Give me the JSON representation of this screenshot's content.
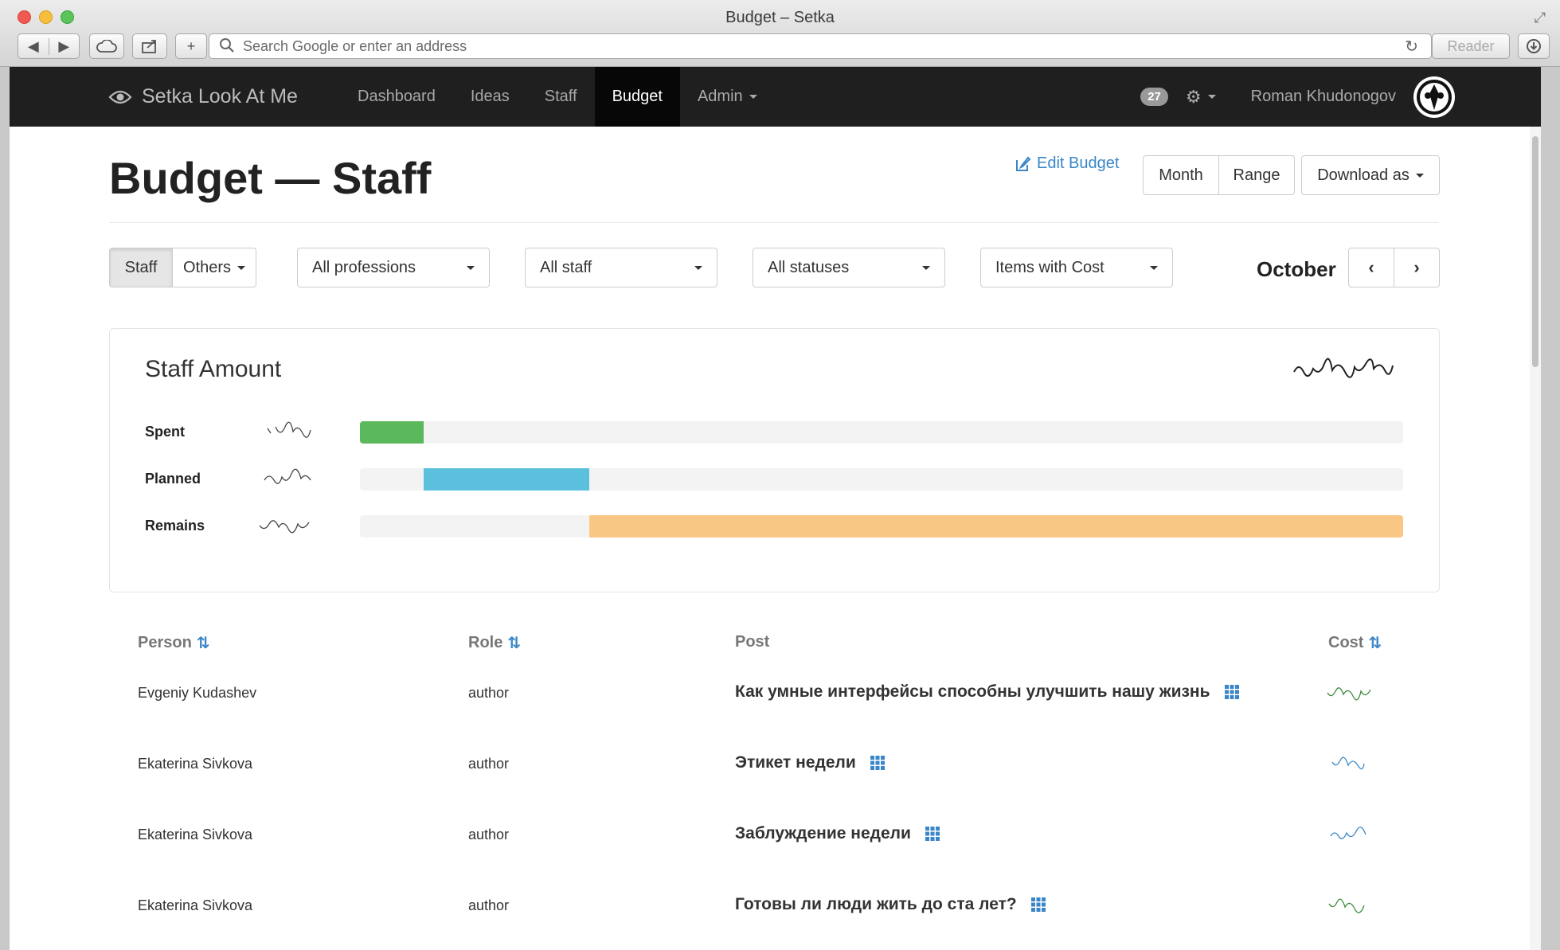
{
  "window": {
    "title": "Budget – Setka"
  },
  "browser": {
    "address_placeholder": "Search Google or enter an address",
    "reader_label": "Reader"
  },
  "navbar": {
    "brand": "Setka Look At Me",
    "items": [
      {
        "label": "Dashboard",
        "active": false
      },
      {
        "label": "Ideas",
        "active": false
      },
      {
        "label": "Staff",
        "active": false
      },
      {
        "label": "Budget",
        "active": true
      },
      {
        "label": "Admin",
        "active": false
      }
    ],
    "notifications": "27",
    "user_name": "Roman Khudonogov"
  },
  "header": {
    "title": "Budget — Staff",
    "edit_label": "Edit Budget",
    "month_label": "Month",
    "range_label": "Range",
    "download_label": "Download as"
  },
  "filters": {
    "staff_label": "Staff",
    "others_label": "Others",
    "professions": "All professions",
    "staff": "All staff",
    "statuses": "All statuses",
    "cost": "Items with Cost",
    "current_month": "October"
  },
  "summary": {
    "title": "Staff Amount",
    "rows": [
      {
        "label": "Spent",
        "start": 0.0,
        "fraction": 0.061,
        "color": "#5cb85c"
      },
      {
        "label": "Planned",
        "start": 0.061,
        "fraction": 0.159,
        "color": "#5bc0de"
      },
      {
        "label": "Remains",
        "start": 0.22,
        "fraction": 0.78,
        "color": "#f9c784"
      }
    ]
  },
  "table": {
    "columns": [
      "Person",
      "Role",
      "Post",
      "Cost"
    ],
    "rows": [
      {
        "person": "Evgeniy Kudashev",
        "role": "author",
        "post": "Как умные интерфейсы способны улучшить нашу жизнь",
        "status": "green"
      },
      {
        "person": "Ekaterina Sivkova",
        "role": "author",
        "post": "Этикет недели",
        "status": "blue"
      },
      {
        "person": "Ekaterina Sivkova",
        "role": "author",
        "post": "Заблуждение недели",
        "status": "blue"
      },
      {
        "person": "Ekaterina Sivkova",
        "role": "author",
        "post": "Готовы ли люди жить до ста лет?",
        "status": "green"
      }
    ]
  },
  "colors": {
    "accent": "#3a86c8",
    "navbar": "#1f1f1f",
    "row_green": "#dff0d8",
    "row_blue": "#e6f0f9"
  }
}
